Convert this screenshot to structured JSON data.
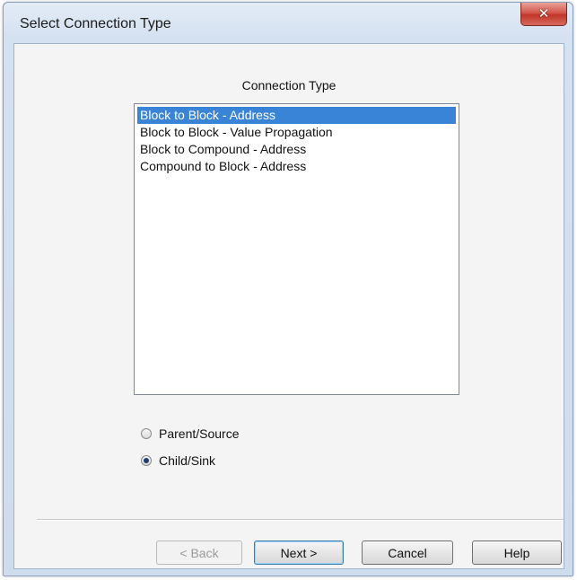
{
  "window": {
    "title": "Select Connection Type",
    "close_icon": "close-icon",
    "close_glyph": "✕"
  },
  "connection_type": {
    "label": "Connection Type",
    "items": [
      {
        "label": "Block to Block - Address",
        "selected": true
      },
      {
        "label": "Block to Block - Value Propagation",
        "selected": false
      },
      {
        "label": "Block to Compound - Address",
        "selected": false
      },
      {
        "label": "Compound to Block - Address",
        "selected": false
      }
    ]
  },
  "role": {
    "options": [
      {
        "label": "Parent/Source",
        "checked": false
      },
      {
        "label": "Child/Sink",
        "checked": true
      }
    ]
  },
  "buttons": {
    "back": "< Back",
    "next": "Next >",
    "cancel": "Cancel",
    "help": "Help"
  },
  "colors": {
    "selection": "#3a84d8",
    "close_button": "#c0352a"
  }
}
